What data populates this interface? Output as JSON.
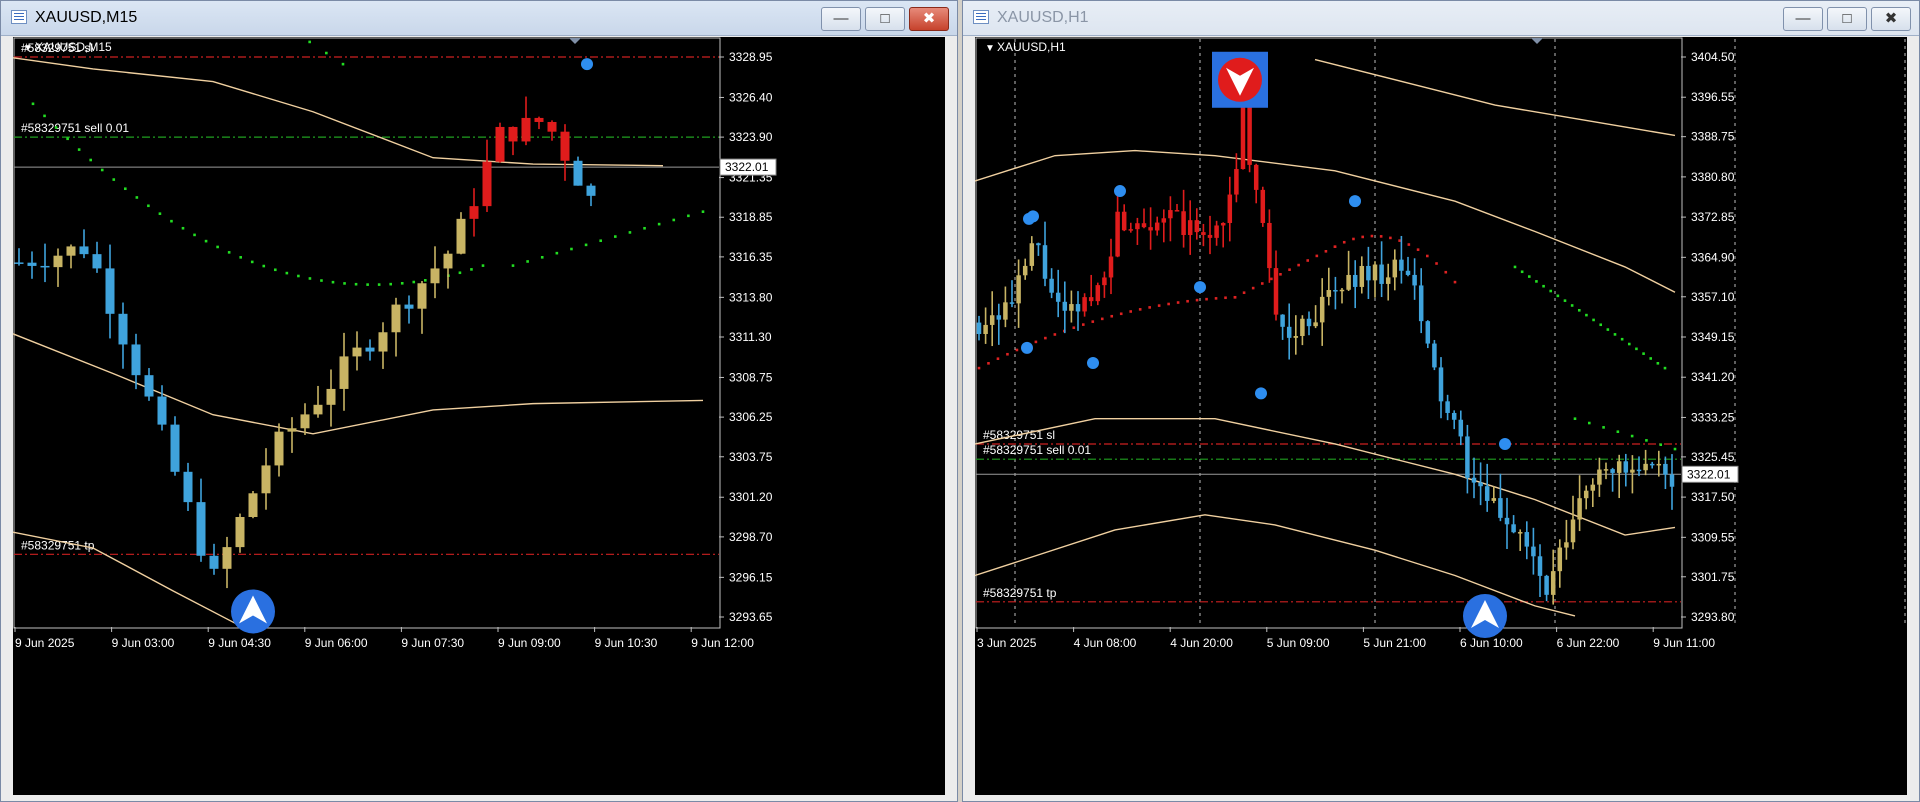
{
  "windows": [
    {
      "id": "m15",
      "title": "XAUUSD,M15",
      "chart_label": "XAUUSD,M15",
      "active": true,
      "price_labels": [
        "3328.95",
        "3326.40",
        "3323.90",
        "3321.35",
        "3318.85",
        "3316.35",
        "3313.80",
        "3311.30",
        "3308.75",
        "3306.25",
        "3303.75",
        "3301.20",
        "3298.70",
        "3296.15",
        "3293.65"
      ],
      "current_price": "3322.01",
      "time_labels": [
        "9 Jun 2025",
        "9 Jun 03:00",
        "9 Jun 04:30",
        "9 Jun 06:00",
        "9 Jun 07:30",
        "9 Jun 09:00",
        "9 Jun 10:30",
        "9 Jun 12:00"
      ],
      "orders": {
        "sl": "#58329751 sl",
        "sell": "#58329751 sell 0.01",
        "tp": "#58329751 tp"
      },
      "order_prices": {
        "sl": 3328.95,
        "sell": 3323.9,
        "tp": 3297.6
      }
    },
    {
      "id": "h1",
      "title": "XAUUSD,H1",
      "chart_label": "XAUUSD,H1",
      "active": false,
      "price_labels": [
        "3404.50",
        "3396.55",
        "3388.75",
        "3380.80",
        "3372.85",
        "3364.90",
        "3357.10",
        "3349.15",
        "3341.20",
        "3333.25",
        "3325.45",
        "3317.50",
        "3309.55",
        "3301.75",
        "3293.80"
      ],
      "current_price": "3322.01",
      "time_labels": [
        "3 Jun 2025",
        "4 Jun 08:00",
        "4 Jun 20:00",
        "5 Jun 09:00",
        "5 Jun 21:00",
        "6 Jun 10:00",
        "6 Jun 22:00",
        "9 Jun 11:00"
      ],
      "orders": {
        "sl": "#58329751 sl",
        "sell": "#58329751 sell 0.01",
        "tp": "#58329751 tp"
      },
      "order_prices": {
        "sl": 3328.0,
        "sell": 3325.0,
        "tp": 3296.8
      }
    }
  ],
  "colors": {
    "bull": "#c8b464",
    "bear_blue": "#3fa3dc",
    "bear_red": "#e01c1c",
    "ma": "#f0d0a0",
    "sar_green": "#22dd22",
    "sar_red": "#dd2222",
    "sl_line": "#cc2020",
    "sell_line": "#20a020"
  },
  "icons": {
    "buy_signal": "up-triangle-circle-icon",
    "sell_signal": "down-triangle-circle-icon",
    "swing_point": "blue-dot-icon"
  }
}
